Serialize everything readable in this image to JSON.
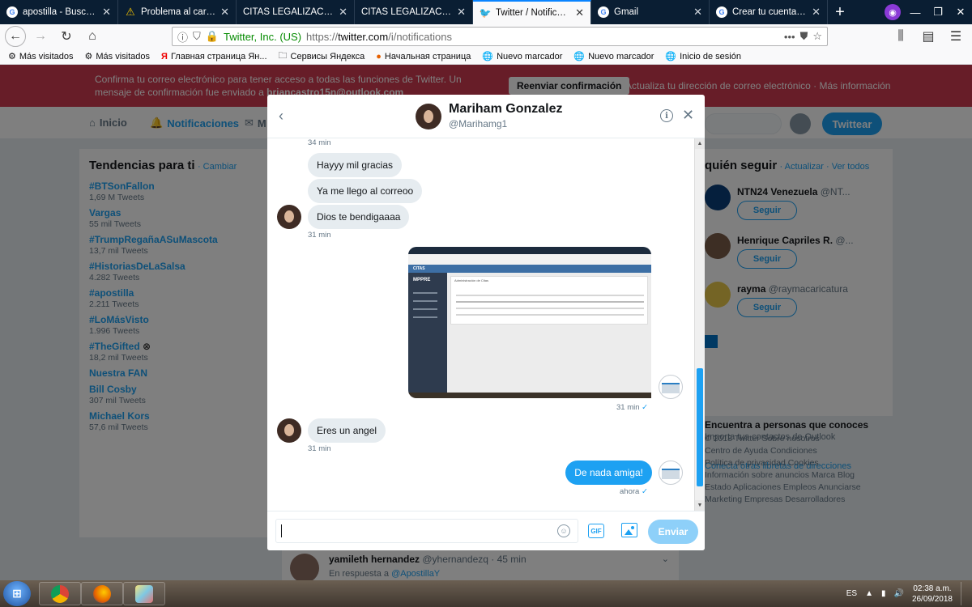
{
  "browser": {
    "tabs": [
      {
        "title": "apostilla - Buscar con",
        "icon": "google-icon"
      },
      {
        "title": "Problema al cargar la",
        "icon": "warning-icon"
      },
      {
        "title": "CITAS LEGALIZACIONES |",
        "icon": ""
      },
      {
        "title": "CITAS LEGALIZACIONES |",
        "icon": ""
      },
      {
        "title": "Twitter / Notificacion",
        "icon": "twitter-icon",
        "active": true
      },
      {
        "title": "Gmail",
        "icon": "google-icon"
      },
      {
        "title": "Crear tu cuenta de Go",
        "icon": "google-icon"
      }
    ],
    "url_site": "Twitter, Inc. (US)",
    "url_prefix": "https://",
    "url_host": "twitter.com",
    "url_path": "/i/notifications",
    "bookmarks": [
      "Más visitados",
      "Más visitados",
      "Главная страница Ян...",
      "Сервисы Яндекса",
      "Начальная страница",
      "Nuevo marcador",
      "Nuevo marcador",
      "Inicio de sesión"
    ]
  },
  "banner": {
    "text": "Confirma tu correo electrónico para tener acceso a todas las funciones de Twitter. Un mensaje de confirmación fue enviado a ",
    "email": "briancastro15n@outlook.com",
    "resend": "Reenviar confirmación",
    "links": "Actualiza tu dirección de correo electrónico · Más información"
  },
  "twitter_nav": {
    "home": "Inicio",
    "notifications": "Notificaciones",
    "messages": "M",
    "tweet_button": "Twittear"
  },
  "trends": {
    "title": "Tendencias para ti",
    "change": "· Cambiar",
    "items": [
      {
        "name": "#BTSonFallon",
        "count": "1,69 M Tweets"
      },
      {
        "name": "Vargas",
        "count": "55 mil Tweets"
      },
      {
        "name": "#TrumpRegañaASuMascota",
        "count": "13,7 mil Tweets"
      },
      {
        "name": "#HistoriasDeLaSalsa",
        "count": "4.282 Tweets"
      },
      {
        "name": "#apostilla",
        "count": "2.211 Tweets"
      },
      {
        "name": "#LoMásVisto",
        "count": "1.996 Tweets"
      },
      {
        "name": "#TheGifted",
        "count": "18,2 mil Tweets"
      },
      {
        "name": "Nuestra FAN",
        "count": ""
      },
      {
        "name": "Bill Cosby",
        "count": "307 mil Tweets"
      },
      {
        "name": "Michael Kors",
        "count": "57,6 mil Tweets"
      }
    ]
  },
  "who_to_follow": {
    "title": "quién seguir",
    "links": "· Actualizar · Ver todos",
    "items": [
      {
        "name": "NTN24 Venezuela",
        "handle": "@NT..."
      },
      {
        "name": "Henrique Capriles R.",
        "handle": "@..."
      },
      {
        "name": "rayma",
        "handle": "@raymacaricatura"
      }
    ],
    "follow_label": "Seguir",
    "find_people": "Encuentra a personas que conoces",
    "import_contacts": "Importa tus contactos de Outlook",
    "other_books": "Conecta otras libretas de direcciones"
  },
  "footer": {
    "lines": [
      "© 2018 Twitter   Sobre nosotros",
      "Centro de Ayuda   Condiciones",
      "Política de privacidad   Cookies",
      "Información sobre anuncios   Marca   Blog",
      "Estado   Aplicaciones   Empleos   Anunciarse",
      "Marketing   Empresas   Desarrolladores"
    ]
  },
  "reply_tweet": {
    "name": "yamileth hernandez",
    "meta": "@yhernandezq · 45 min",
    "reply_prefix": "En respuesta a ",
    "mention": "@ApostillaY"
  },
  "dm": {
    "name": "Mariham Gonzalez",
    "handle": "@Marihamg1",
    "messages": {
      "t1": "34 min",
      "m1": "Hayyy mil gracias",
      "m2": "Ya me llego al correoo",
      "m3": "Dios te bendigaaaa",
      "t2": "31 min",
      "t3": "31 min",
      "m4": "Eres un angel",
      "t4": "31 min",
      "m5": "De nada amiga!",
      "t5": "ahora"
    },
    "screenshot": {
      "header": "CITAS",
      "logo": "MPPRE",
      "title": "Administración de Citas"
    },
    "input_value": "",
    "send_label": "Enviar",
    "gif_label": "GIF"
  },
  "taskbar": {
    "lang": "ES",
    "time": "02:38 a.m.",
    "date": "26/09/2018"
  },
  "colors": {
    "twitter_blue": "#1da1f2",
    "banner_red": "#cf3a51",
    "tab_bar": "#0a1e33"
  }
}
